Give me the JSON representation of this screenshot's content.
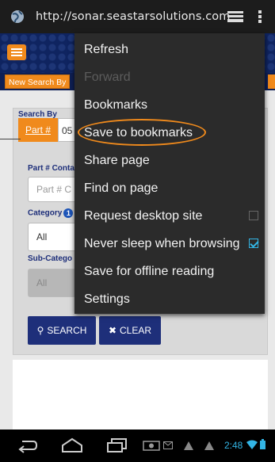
{
  "browser": {
    "url": "http://sonar.seastarsolutions.com",
    "icons": [
      "globe-icon",
      "tabs-icon",
      "overflow-menu-icon"
    ]
  },
  "page": {
    "nav_tab": "New Search By",
    "search_by_label": "Search By",
    "part_button": "Part #",
    "part_value": "05",
    "part_contains_label": "Part # Conta",
    "part_contains_placeholder": "Part # C",
    "category_label": "Category",
    "category_info": "1",
    "category_value": "All",
    "subcategory_label": "Sub-Catego",
    "subcategory_value": "All",
    "search_button": "SEARCH",
    "clear_button": "CLEAR"
  },
  "menu": {
    "items": [
      {
        "label": "Refresh",
        "enabled": true
      },
      {
        "label": "Forward",
        "enabled": false
      },
      {
        "label": "Bookmarks",
        "enabled": true
      },
      {
        "label": "Save to bookmarks",
        "enabled": true,
        "highlighted": true
      },
      {
        "label": "Share page",
        "enabled": true
      },
      {
        "label": "Find on page",
        "enabled": true
      },
      {
        "label": "Request desktop site",
        "enabled": true,
        "checkbox": false
      },
      {
        "label": "Never sleep when browsing",
        "enabled": true,
        "checkbox": true
      },
      {
        "label": "Save for offline reading",
        "enabled": true
      },
      {
        "label": "Settings",
        "enabled": true
      }
    ]
  },
  "status": {
    "time": "2:48"
  },
  "colors": {
    "accent_orange": "#f08a1c",
    "navy": "#1e2f7a",
    "holo_blue": "#33b5e5"
  }
}
